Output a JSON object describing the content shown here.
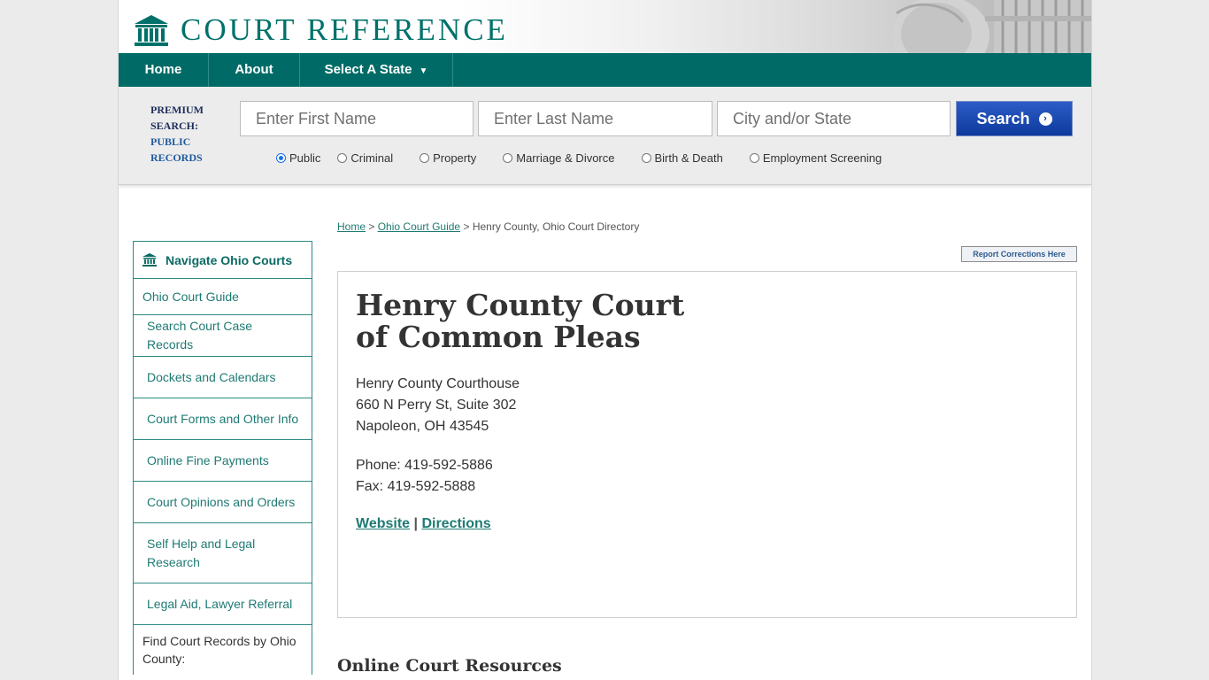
{
  "header": {
    "logo_text": "COURT REFERENCE",
    "icon": "courthouse-icon"
  },
  "nav": {
    "home": "Home",
    "about": "About",
    "select_state": "Select A State",
    "caret": "▼"
  },
  "search": {
    "premium_line1": "PREMIUM",
    "premium_line2": "SEARCH:",
    "premium_line3": "PUBLIC",
    "premium_line4": "RECORDS",
    "first_placeholder": "Enter First Name",
    "last_placeholder": "Enter Last Name",
    "city_placeholder": "City and/or State",
    "button_label": "Search",
    "button_icon": "›",
    "radios": [
      "Public",
      "Criminal",
      "Property",
      "Marriage & Divorce",
      "Birth & Death",
      "Employment Screening"
    ],
    "selected_radio": "Public"
  },
  "sidebar": {
    "heading": "Navigate Ohio Courts",
    "items": [
      "Ohio Court Guide",
      "Search Court Case Records",
      "Dockets and Calendars",
      "Court Forms and Other Info",
      "Online Fine Payments",
      "Court Opinions and Orders",
      "Self Help and Legal Research",
      "Legal Aid, Lawyer Referral"
    ],
    "county_label": "Find Court Records by Ohio County:"
  },
  "breadcrumb": {
    "home": "Home",
    "sep": ">",
    "guide": "Ohio Court Guide",
    "current": "Henry County, Ohio Court Directory"
  },
  "report_button": "Report Corrections Here",
  "court": {
    "title": "Henry County Court of Common Pleas",
    "address_line1": "Henry County Courthouse",
    "address_line2": "660 N Perry St, Suite 302",
    "address_line3": "Napoleon, OH 43545",
    "phone": "Phone: 419-592-5886",
    "fax": "Fax: 419-592-5888",
    "website_label": "Website",
    "link_sep": "|",
    "directions_label": "Directions"
  },
  "resources_title": "Online Court Resources",
  "colors": {
    "brand_teal": "#006b66",
    "link_teal": "#1f7a73",
    "search_blue": "#0d3a9c"
  }
}
